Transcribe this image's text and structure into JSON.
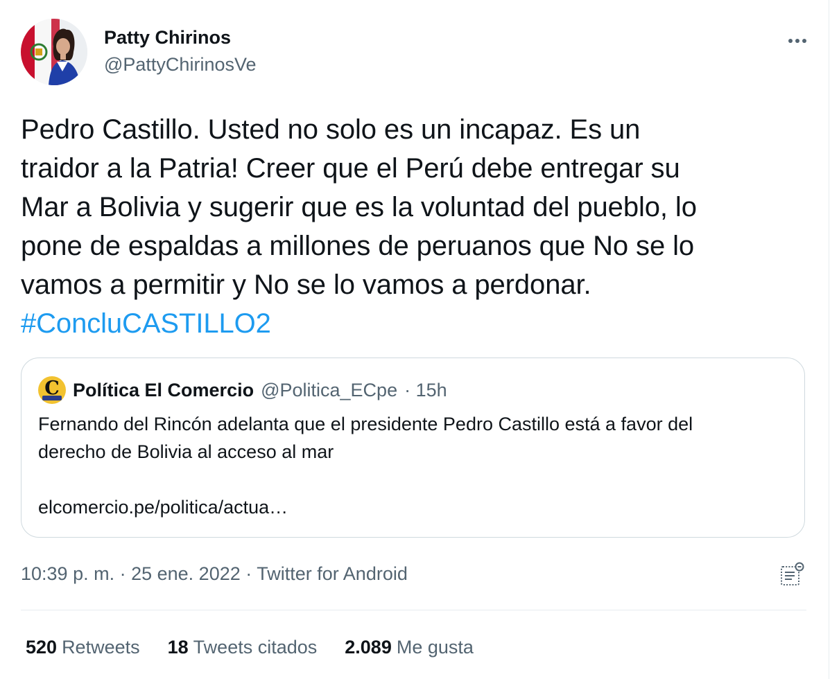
{
  "author": {
    "name": "Patty Chirinos",
    "handle": "@PattyChirinosVe"
  },
  "tweet": {
    "lines": [
      "Pedro Castillo. Usted no solo es un incapaz. Es un",
      "traidor a la Patria! Creer que el Perú debe entregar su",
      "Mar a Bolivia y sugerir que es la voluntad del pueblo, lo",
      "pone de espaldas a millones de peruanos que No se lo",
      "vamos a permitir y No se lo vamos a perdonar."
    ],
    "hashtag": "#ConcluCASTILLO2"
  },
  "quoted": {
    "name": "Política El Comercio",
    "handle": "@Politica_ECpe",
    "time": "· 15h",
    "logo_letter": "C",
    "body_lines": [
      "Fernando del Rincón adelanta que el presidente Pedro Castillo está a favor del",
      "derecho de Bolivia al acceso al mar"
    ],
    "link": "elcomercio.pe/politica/actua…"
  },
  "meta": {
    "time": "10:39 p. m.",
    "sep1": " · ",
    "date": "25 ene. 2022",
    "sep2": " · ",
    "source": "Twitter for Android"
  },
  "stats": {
    "retweets": {
      "count": "520",
      "label": "Retweets"
    },
    "quotes": {
      "count": "18",
      "label": "Tweets citados"
    },
    "likes": {
      "count": "2.089",
      "label": "Me gusta"
    }
  },
  "icons": {
    "more": "more-horizontal-icon",
    "analytics": "analytics-icon"
  },
  "colors": {
    "text": "#0f1419",
    "secondary": "#536471",
    "link": "#1d9bf0",
    "border": "#cfd9de",
    "divider": "#e6ecf0"
  }
}
